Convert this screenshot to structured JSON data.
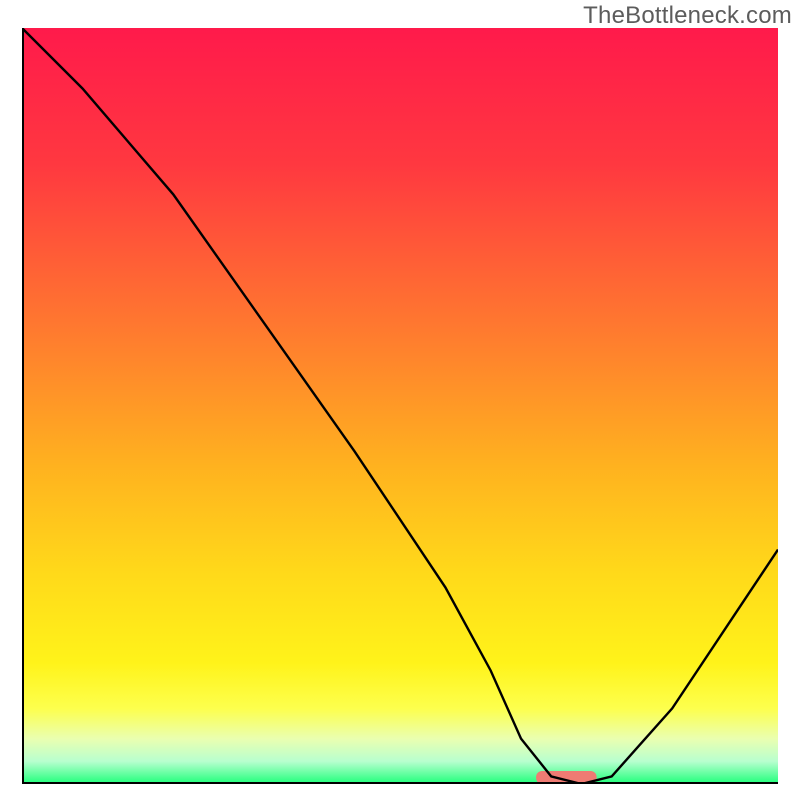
{
  "watermark": "TheBottleneck.com",
  "chart_data": {
    "type": "line",
    "title": "",
    "xlabel": "",
    "ylabel": "",
    "x_range": [
      0,
      100
    ],
    "y_range": [
      0,
      100
    ],
    "gradient_stops": [
      {
        "offset": 0.0,
        "color": "#ff1a4b"
      },
      {
        "offset": 0.18,
        "color": "#ff3840"
      },
      {
        "offset": 0.4,
        "color": "#ff7a2f"
      },
      {
        "offset": 0.58,
        "color": "#ffb21f"
      },
      {
        "offset": 0.72,
        "color": "#ffd91a"
      },
      {
        "offset": 0.84,
        "color": "#fff31a"
      },
      {
        "offset": 0.9,
        "color": "#fdff4d"
      },
      {
        "offset": 0.94,
        "color": "#eaffb0"
      },
      {
        "offset": 0.97,
        "color": "#b8ffcf"
      },
      {
        "offset": 1.0,
        "color": "#1eff7a"
      }
    ],
    "series": [
      {
        "name": "bottleneck-curve",
        "x": [
          0,
          8,
          20,
          32,
          44,
          56,
          62,
          66,
          70,
          74,
          78,
          86,
          94,
          100
        ],
        "y": [
          100,
          92,
          78,
          61,
          44,
          26,
          15,
          6,
          1,
          0,
          1,
          10,
          22,
          31
        ]
      }
    ],
    "marker": {
      "name": "optimal-marker",
      "x_center": 72,
      "width": 8,
      "color": "#ef7b73"
    },
    "axes_color": "#000000",
    "curve_color": "#000000"
  }
}
